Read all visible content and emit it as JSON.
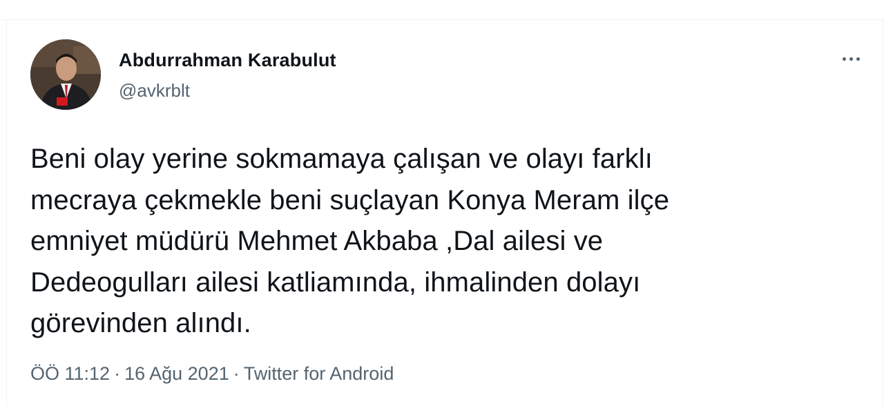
{
  "tweet": {
    "author": {
      "display_name": "Abdurrahman Karabulut",
      "handle": "@avkrblt"
    },
    "text": "Beni olay yerine sokmamaya çalışan ve olayı farklı\nmecraya çekmekle beni suçlayan Konya Meram ilçe\nemniyet müdürü Mehmet Akbaba ,Dal ailesi ve\nDedeogulları ailesi katliamında, ihmalinden dolayı\ngörevinden alındı.",
    "time": "ÖÖ 11:12",
    "separator": "·",
    "date": "16 Ağu 2021",
    "source": "Twitter for Android",
    "more_icon": "more-horizontal-icon"
  },
  "colors": {
    "text_primary": "#0f1419",
    "text_secondary": "#536471",
    "border": "#eff3f4"
  }
}
